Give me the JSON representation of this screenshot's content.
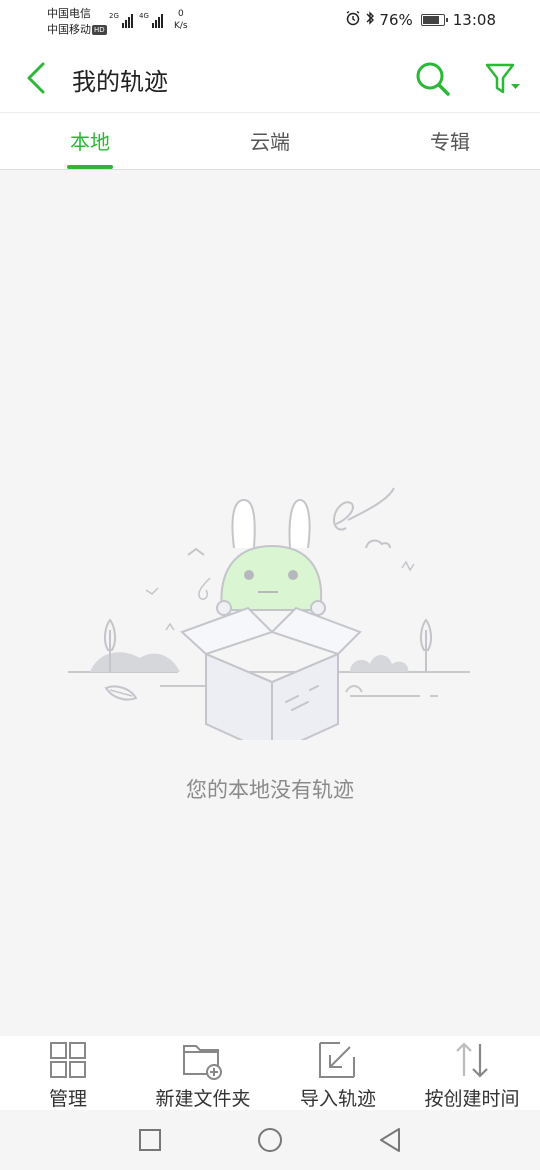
{
  "status_bar": {
    "carrier1": "中国电信",
    "carrier2": "中国移动",
    "hd_badge": "HD",
    "net1": "2G",
    "net2": "4G",
    "speed_value": "0",
    "speed_unit": "K/s",
    "battery_percent": "76%",
    "battery_level": 0.76,
    "time": "13:08"
  },
  "header": {
    "title": "我的轨迹",
    "back_icon": "chevron-left-icon",
    "search_icon": "search-icon",
    "filter_icon": "filter-icon",
    "accent": "#2bb837"
  },
  "tabs": [
    {
      "label": "本地",
      "active": true
    },
    {
      "label": "云端",
      "active": false
    },
    {
      "label": "专辑",
      "active": false
    }
  ],
  "empty_state": {
    "message": "您的本地没有轨迹",
    "illustration": "rabbit-in-box-illustration"
  },
  "toolbar": {
    "manage": "管理",
    "new_folder": "新建文件夹",
    "import": "导入轨迹",
    "sort": "按创建时间"
  },
  "nav": {
    "recent_icon": "square-icon",
    "home_icon": "circle-icon",
    "back_icon": "triangle-back-icon"
  }
}
